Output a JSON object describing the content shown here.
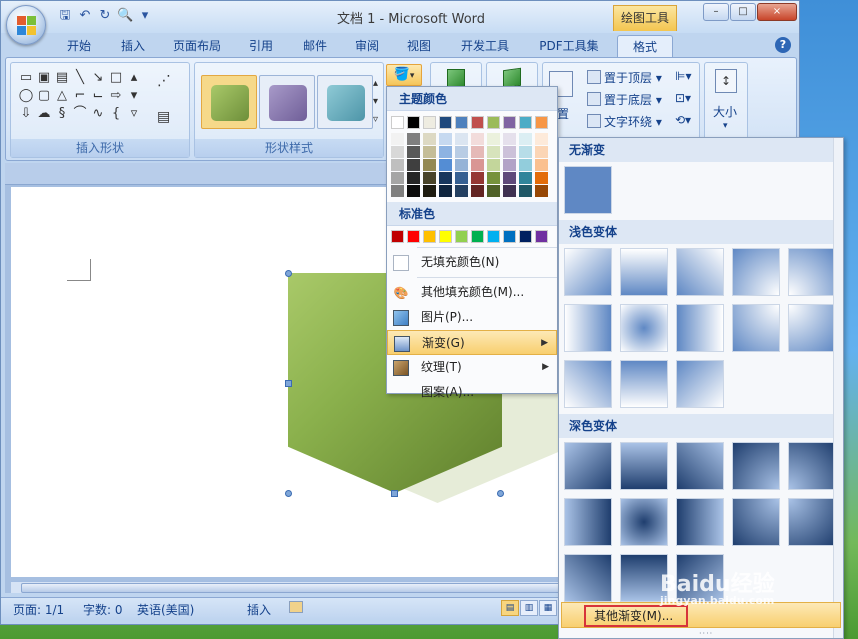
{
  "window": {
    "title": "文档 1 - Microsoft Word",
    "tools_tag": "绘图工具",
    "controls": [
      "–",
      "□",
      "×"
    ]
  },
  "tabs": [
    "开始",
    "插入",
    "页面布局",
    "引用",
    "邮件",
    "审阅",
    "视图",
    "开发工具",
    "PDF工具集",
    "格式"
  ],
  "active_tab": "格式",
  "ribbon": {
    "groups": {
      "insert_shapes": "插入形状",
      "shape_styles": "形状样式",
      "size": "大小"
    },
    "arrange_buttons": [
      "置于顶层",
      "置于底层",
      "文字环绕"
    ],
    "position_label": "置"
  },
  "fill_menu": {
    "theme_colors_header": "主题颜色",
    "standard_colors_header": "标准色",
    "theme_colors": [
      "#ffffff",
      "#000000",
      "#eeece1",
      "#1f497d",
      "#4f81bd",
      "#c0504d",
      "#9bbb59",
      "#8064a2",
      "#4bacc6",
      "#f79646"
    ],
    "theme_shades": [
      [
        "#f2f2f2",
        "#d8d8d8",
        "#bfbfbf",
        "#a5a5a5",
        "#7f7f7f"
      ],
      [
        "#7f7f7f",
        "#595959",
        "#3f3f3f",
        "#262626",
        "#0c0c0c"
      ],
      [
        "#ddd9c3",
        "#c4bd97",
        "#938953",
        "#494429",
        "#1d1b10"
      ],
      [
        "#c6d9f0",
        "#8db3e2",
        "#548dd4",
        "#17365d",
        "#0f243e"
      ],
      [
        "#dbe5f1",
        "#b8cce4",
        "#95b3d7",
        "#366092",
        "#244061"
      ],
      [
        "#f2dcdb",
        "#e5b9b7",
        "#d99694",
        "#953734",
        "#632423"
      ],
      [
        "#ebf1dd",
        "#d7e3bc",
        "#c3d69b",
        "#76923c",
        "#4f6128"
      ],
      [
        "#e5e0ec",
        "#ccc1d9",
        "#b2a2c7",
        "#5f497a",
        "#3f3151"
      ],
      [
        "#dbeef3",
        "#b7dde8",
        "#92cddc",
        "#31859b",
        "#205867"
      ],
      [
        "#fdeada",
        "#fbd5b5",
        "#fac08f",
        "#e36c09",
        "#974806"
      ]
    ],
    "standard_colors": [
      "#c00000",
      "#ff0000",
      "#ffc000",
      "#ffff00",
      "#92d050",
      "#00b050",
      "#00b0f0",
      "#0070c0",
      "#002060",
      "#7030a0"
    ],
    "items": [
      {
        "label": "无填充颜色(N)",
        "icon": "no-fill-icon"
      },
      {
        "label": "其他填充颜色(M)...",
        "icon": "palette-icon"
      },
      {
        "label": "图片(P)...",
        "icon": "picture-icon"
      },
      {
        "label": "渐变(G)",
        "icon": "gradient-icon",
        "submenu": true,
        "highlighted": true
      },
      {
        "label": "纹理(T)",
        "icon": "texture-icon",
        "submenu": true
      },
      {
        "label": "图案(A)...",
        "icon": "pattern-icon"
      }
    ]
  },
  "gradient_panel": {
    "no_gradient_header": "无渐变",
    "light_header": "浅色变体",
    "dark_header": "深色变体",
    "more_label": "其他渐变(M)...",
    "base_color": "#5f88c4"
  },
  "statusbar": {
    "page": "页面: 1/1",
    "words": "字数: 0",
    "language": "英语(美国)",
    "mode": "插入"
  },
  "watermark": {
    "brand": "Baidu经验",
    "url": "jingyan.baidu.com"
  }
}
